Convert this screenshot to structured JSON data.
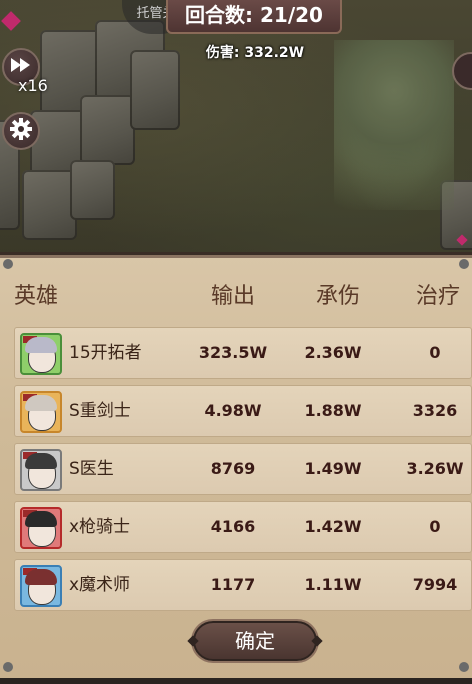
{
  "hud": {
    "auto_label": "托管关",
    "round_text": "回合数: 21/20",
    "damage_text": "伤害: 332.2W",
    "speed_label": "x16",
    "speed_icon": "fast-forward-icon",
    "settings_icon": "gear-icon"
  },
  "table": {
    "headers": [
      "英雄",
      "输出",
      "承伤",
      "治疗"
    ],
    "rows": [
      {
        "name": "15开拓者",
        "output": "323.5W",
        "damage_taken": "2.36W",
        "healing": "0",
        "frame_color": "#4a8f3a",
        "hair_color": "#b9b9c9"
      },
      {
        "name": "S重剑士",
        "output": "4.98W",
        "damage_taken": "1.88W",
        "healing": "3326",
        "frame_color": "#c7862b",
        "hair_color": "#cfc8c0"
      },
      {
        "name": "S医生",
        "output": "8769",
        "damage_taken": "1.49W",
        "healing": "3.26W",
        "frame_color": "#7a7a7a",
        "hair_color": "#3a3a3a"
      },
      {
        "name": "x枪骑士",
        "output": "4166",
        "damage_taken": "1.42W",
        "healing": "0",
        "frame_color": "#b52a2a",
        "hair_color": "#2a2a2a"
      },
      {
        "name": "x魔术师",
        "output": "1177",
        "damage_taken": "1.11W",
        "healing": "7994",
        "frame_color": "#3a7fb5",
        "hair_color": "#7a3030"
      }
    ]
  },
  "confirm_label": "确定",
  "colors": {
    "panel_bg": "#d9c6a8",
    "header_text": "#5a3a28",
    "value_text": "#3a1a16",
    "button_bg": "#5a4038"
  }
}
